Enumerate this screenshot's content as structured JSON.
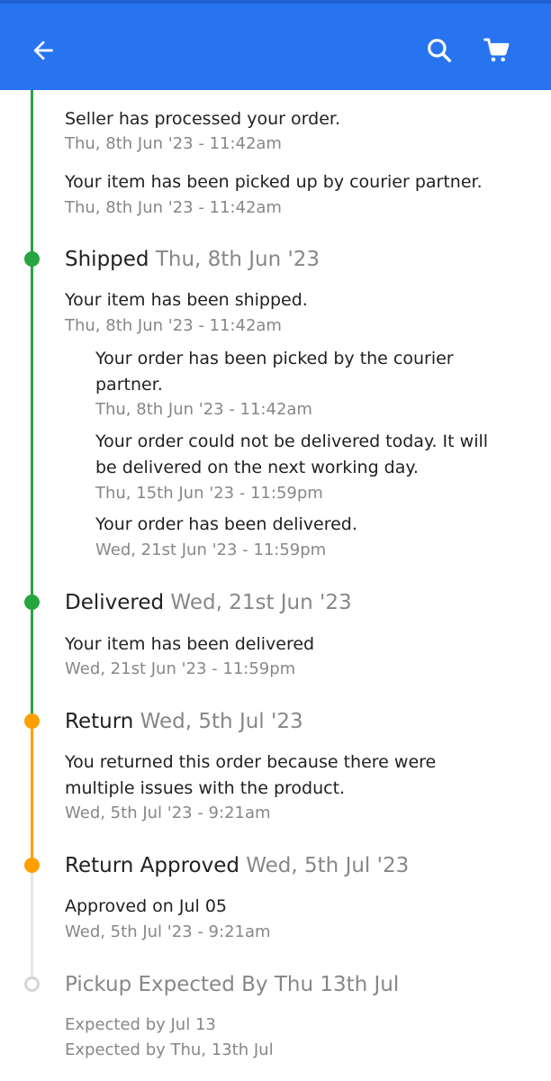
{
  "colors": {
    "header_bg": "#2874f0",
    "completed": "#26a541",
    "return": "#ff9f00",
    "pending": "#d6d6d6",
    "secondary_text": "#878787"
  },
  "header": {
    "back_icon": "arrow-left-icon",
    "search_icon": "search-icon",
    "cart_icon": "cart-icon"
  },
  "timeline": {
    "ordered": {
      "events": [
        {
          "message": "Seller has processed your order.",
          "time": "Thu, 8th Jun '23 - 11:42am"
        },
        {
          "message": "Your item has been picked up by courier partner.",
          "time": "Thu, 8th Jun '23 - 11:42am"
        }
      ]
    },
    "shipped": {
      "title": "Shipped",
      "date": "Thu, 8th Jun '23",
      "events": [
        {
          "message": "Your item has been shipped.",
          "time": "Thu, 8th Jun '23 - 11:42am"
        }
      ],
      "sub_events": [
        {
          "message": "Your order has been picked by the courier partner.",
          "time": "Thu, 8th Jun '23 - 11:42am"
        },
        {
          "message": "Your order could not be delivered today. It will be delivered on the next working day.",
          "time": "Thu, 15th Jun '23 - 11:59pm"
        },
        {
          "message": "Your order has been delivered.",
          "time": "Wed, 21st Jun '23 - 11:59pm"
        }
      ]
    },
    "delivered": {
      "title": "Delivered",
      "date": "Wed, 21st Jun '23",
      "events": [
        {
          "message": "Your item has been delivered",
          "time": "Wed, 21st Jun '23 - 11:59pm"
        }
      ]
    },
    "return": {
      "title": "Return",
      "date": "Wed, 5th Jul '23",
      "events": [
        {
          "message": "You returned this order because there were multiple issues with the product.",
          "time": "Wed, 5th Jul '23 - 9:21am"
        }
      ]
    },
    "return_approved": {
      "title": "Return Approved",
      "date": "Wed, 5th Jul '23",
      "events": [
        {
          "message": "Approved on Jul 05",
          "time": "Wed, 5th Jul '23 - 9:21am"
        }
      ]
    },
    "pickup_expected": {
      "title": "Pickup Expected By Thu 13th Jul",
      "events": [
        {
          "message": "Expected by Jul 13",
          "time": "Expected by Thu, 13th Jul"
        }
      ]
    }
  }
}
